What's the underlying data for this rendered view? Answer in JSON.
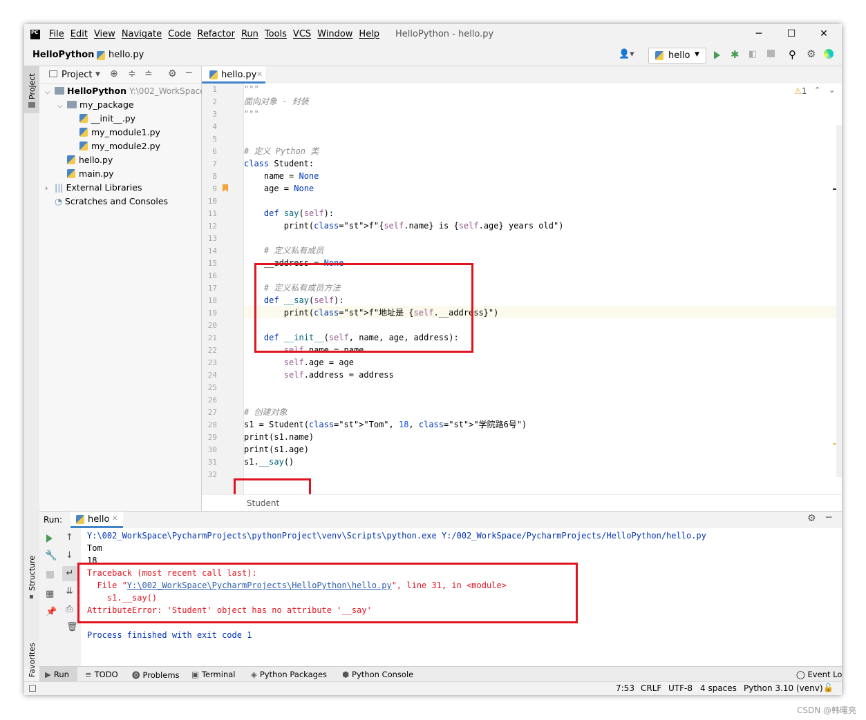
{
  "app": {
    "logo_text": "PC",
    "menu": [
      "File",
      "Edit",
      "View",
      "Navigate",
      "Code",
      "Refactor",
      "Run",
      "Tools",
      "VCS",
      "Window",
      "Help"
    ],
    "window_title": "HelloPython - hello.py",
    "win_controls": {
      "minimize": "─",
      "maximize": "☐",
      "close": "✕"
    }
  },
  "navbar": {
    "project": "HelloPython",
    "file": "hello.py",
    "run_config": "hello"
  },
  "project_panel": {
    "title": "Project",
    "tree": [
      {
        "label": "HelloPython",
        "suffix": "Y:\\002_WorkSpace",
        "kind": "folder",
        "depth": 0,
        "expanded": true
      },
      {
        "label": "my_package",
        "kind": "folder",
        "depth": 1,
        "expanded": true
      },
      {
        "label": "__init__.py",
        "kind": "py",
        "depth": 2
      },
      {
        "label": "my_module1.py",
        "kind": "py",
        "depth": 2
      },
      {
        "label": "my_module2.py",
        "kind": "py",
        "depth": 2
      },
      {
        "label": "hello.py",
        "kind": "py",
        "depth": 1
      },
      {
        "label": "main.py",
        "kind": "py",
        "depth": 1
      },
      {
        "label": "External Libraries",
        "kind": "lib",
        "depth": 0,
        "expanded": false
      },
      {
        "label": "Scratches and Consoles",
        "kind": "scratch",
        "depth": 0
      }
    ]
  },
  "side_tabs": {
    "project": "Project",
    "structure": "Structure",
    "favorites": "Favorites"
  },
  "editor": {
    "tab": "hello.py",
    "warnings": "1",
    "breadcrumb": "Student",
    "lines": [
      {
        "n": "1",
        "text": "\"\"\""
      },
      {
        "n": "2",
        "text": "面向对象 - 封装"
      },
      {
        "n": "3",
        "text": "\"\"\""
      },
      {
        "n": "4",
        "text": ""
      },
      {
        "n": "5",
        "text": ""
      },
      {
        "n": "6",
        "text": "# 定义 Python 类"
      },
      {
        "n": "7",
        "text": "class Student:"
      },
      {
        "n": "8",
        "text": "    name = None"
      },
      {
        "n": "9",
        "text": "    age = None"
      },
      {
        "n": "10",
        "text": ""
      },
      {
        "n": "11",
        "text": "    def say(self):"
      },
      {
        "n": "12",
        "text": "        print(f\"{self.name} is {self.age} years old\")"
      },
      {
        "n": "13",
        "text": ""
      },
      {
        "n": "14",
        "text": "    # 定义私有成员"
      },
      {
        "n": "15",
        "text": "    __address = None"
      },
      {
        "n": "16",
        "text": ""
      },
      {
        "n": "17",
        "text": "    # 定义私有成员方法"
      },
      {
        "n": "18",
        "text": "    def __say(self):"
      },
      {
        "n": "19",
        "text": "        print(f\"地址是 {self.__address}\")"
      },
      {
        "n": "20",
        "text": ""
      },
      {
        "n": "21",
        "text": "    def __init__(self, name, age, address):"
      },
      {
        "n": "22",
        "text": "        self.name = name"
      },
      {
        "n": "23",
        "text": "        self.age = age"
      },
      {
        "n": "24",
        "text": "        self.address = address"
      },
      {
        "n": "25",
        "text": ""
      },
      {
        "n": "26",
        "text": ""
      },
      {
        "n": "27",
        "text": "# 创建对象"
      },
      {
        "n": "28",
        "text": "s1 = Student(\"Tom\", 18, \"学院路6号\")"
      },
      {
        "n": "29",
        "text": "print(s1.name)"
      },
      {
        "n": "30",
        "text": "print(s1.age)"
      },
      {
        "n": "31",
        "text": "s1.__say()"
      },
      {
        "n": "32",
        "text": ""
      }
    ]
  },
  "run_panel": {
    "label": "Run:",
    "tab": "hello",
    "output": [
      {
        "text": "Y:\\002_WorkSpace\\PycharmProjects\\pythonProject\\venv\\Scripts\\python.exe Y:/002_WorkSpace/PycharmProjects/HelloPython/hello.py",
        "kind": "cmd"
      },
      {
        "text": "Tom",
        "kind": "out"
      },
      {
        "text": "18",
        "kind": "out"
      },
      {
        "text": "Traceback (most recent call last):",
        "kind": "err"
      },
      {
        "text": "  File \"",
        "link": "Y:\\002_WorkSpace\\PycharmProjects\\HelloPython\\hello.py",
        "tail": "\", line 31, in <module>",
        "kind": "errlink"
      },
      {
        "text": "    s1.__say()",
        "kind": "err"
      },
      {
        "text": "AttributeError: 'Student' object has no attribute '__say'",
        "kind": "err"
      },
      {
        "text": "",
        "kind": "out"
      },
      {
        "text": "Process finished with exit code 1",
        "kind": "cmd"
      }
    ]
  },
  "bottom_tools": [
    "Run",
    "TODO",
    "Problems",
    "Terminal",
    "Python Packages",
    "Python Console"
  ],
  "event_log": "Event Log",
  "status": {
    "position": "7:53",
    "line_sep": "CRLF",
    "encoding": "UTF-8",
    "indent": "4 spaces",
    "interpreter": "Python 3.10 (venv)"
  },
  "watermark": "CSDN @韩曙亮",
  "colors": {
    "accent": "#4083c9",
    "highlight": "#e0141e",
    "run_green": "#499c54"
  }
}
